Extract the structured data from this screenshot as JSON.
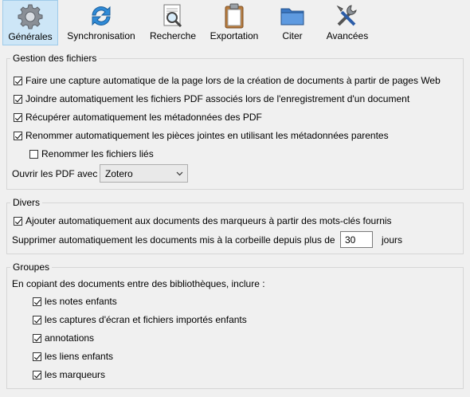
{
  "toolbar": {
    "tabs": [
      {
        "label": "Générales",
        "icon": "gear-icon"
      },
      {
        "label": "Synchronisation",
        "icon": "sync-icon"
      },
      {
        "label": "Recherche",
        "icon": "search-icon"
      },
      {
        "label": "Exportation",
        "icon": "clipboard-icon"
      },
      {
        "label": "Citer",
        "icon": "folder-icon"
      },
      {
        "label": "Avancées",
        "icon": "tools-icon"
      }
    ],
    "selected": "Générales"
  },
  "files": {
    "legend": "Gestion des fichiers",
    "auto_snapshot": {
      "label": "Faire une capture automatique de la page lors de la création de documents à partir de pages Web",
      "checked": true
    },
    "attach_pdf": {
      "label": "Joindre automatiquement les fichiers PDF associés lors de l'enregistrement d'un document",
      "checked": true
    },
    "retrieve_metadata": {
      "label": "Récupérer automatiquement les métadonnées des PDF",
      "checked": true
    },
    "rename_attachments": {
      "label": "Renommer automatiquement les pièces jointes en utilisant les métadonnées parentes",
      "checked": true
    },
    "rename_linked": {
      "label": "Renommer les fichiers liés",
      "checked": false
    },
    "open_pdf_label": "Ouvrir les PDF avec",
    "open_pdf_value": "Zotero"
  },
  "misc": {
    "legend": "Divers",
    "auto_tags": {
      "label": "Ajouter automatiquement aux documents des marqueurs à partir des mots-clés fournis",
      "checked": true
    },
    "trash_label": "Supprimer automatiquement les documents mis à la corbeille depuis plus de",
    "trash_days": "30",
    "trash_unit": "jours"
  },
  "groups": {
    "legend": "Groupes",
    "intro": "En copiant des documents entre des bibliothèques, inclure :",
    "child_notes": {
      "label": "les notes enfants",
      "checked": true
    },
    "child_snapshots": {
      "label": "les captures d'écran et fichiers importés enfants",
      "checked": true
    },
    "annotations": {
      "label": "annotations",
      "checked": true
    },
    "child_links": {
      "label": "les liens enfants",
      "checked": true
    },
    "tags": {
      "label": "les marqueurs",
      "checked": true
    }
  },
  "colors": {
    "selected_tab_bg": "#cde6f7",
    "selected_tab_border": "#9fcbea",
    "background": "#f0f0f0"
  }
}
